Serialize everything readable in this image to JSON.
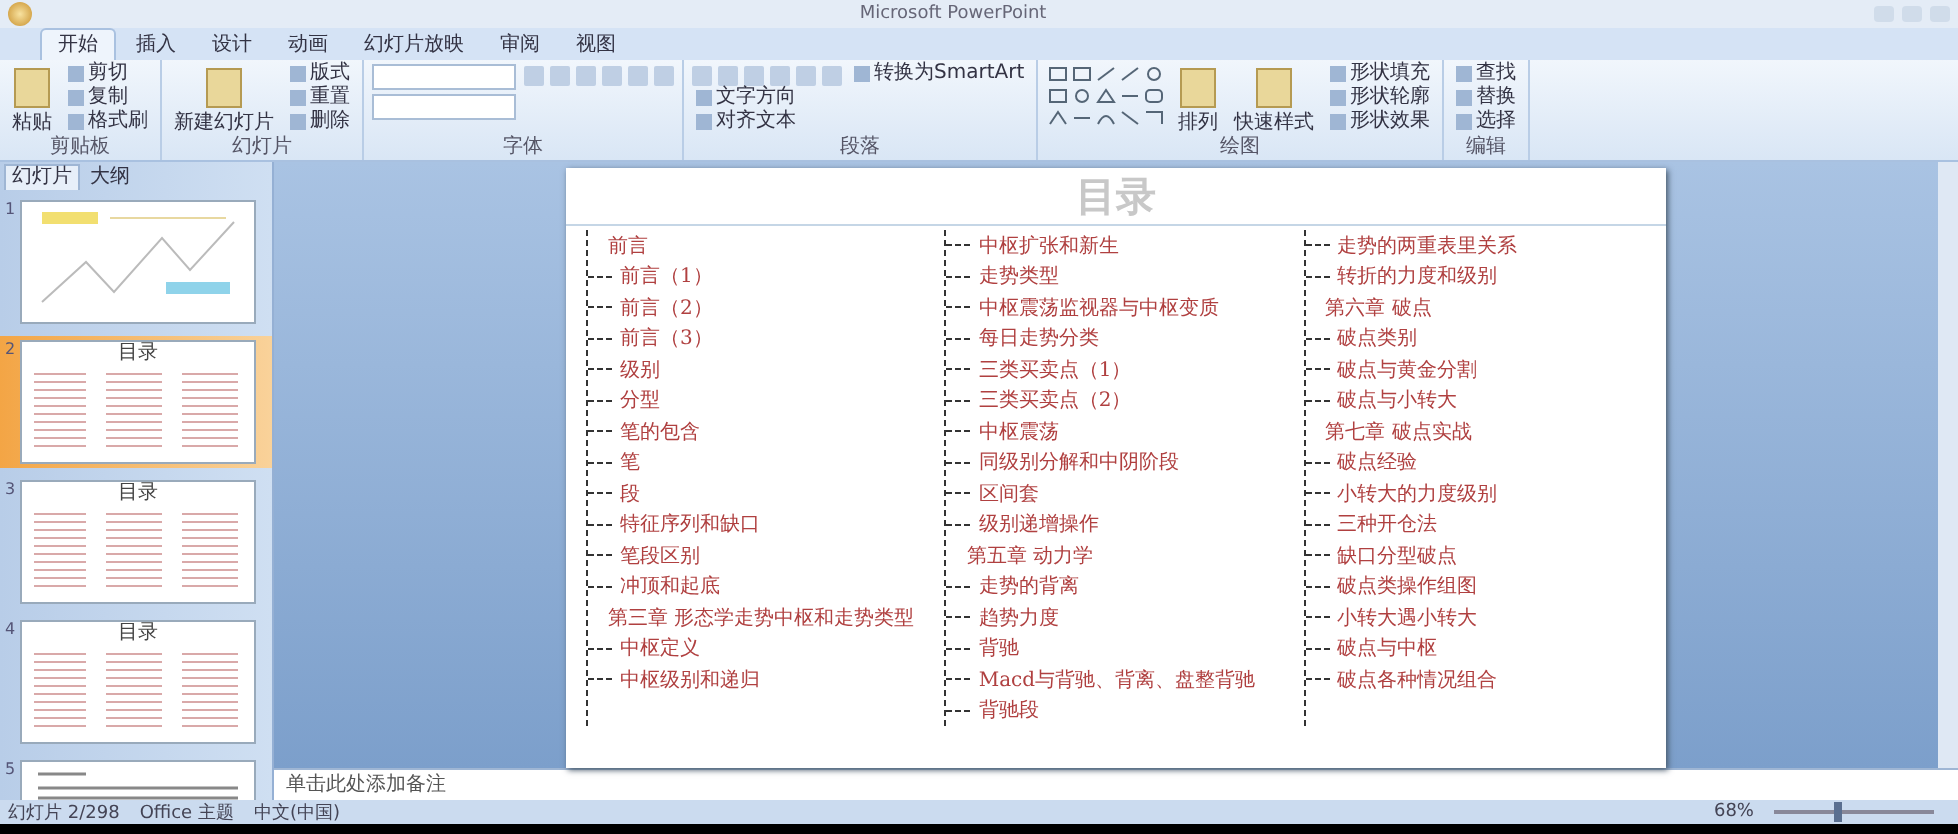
{
  "window": {
    "title": "Microsoft PowerPoint"
  },
  "ribbon_tabs": [
    {
      "label": "开始",
      "selected": true
    },
    {
      "label": "插入",
      "selected": false
    },
    {
      "label": "设计",
      "selected": false
    },
    {
      "label": "动画",
      "selected": false
    },
    {
      "label": "幻灯片放映",
      "selected": false
    },
    {
      "label": "审阅",
      "selected": false
    },
    {
      "label": "视图",
      "selected": false
    }
  ],
  "ribbon_groups": [
    {
      "label": "剪贴板",
      "items": [
        {
          "kind": "large",
          "label": "粘贴"
        },
        {
          "kind": "small",
          "label": "剪切"
        },
        {
          "kind": "small",
          "label": "复制"
        },
        {
          "kind": "small",
          "label": "格式刷"
        }
      ]
    },
    {
      "label": "幻灯片",
      "items": [
        {
          "kind": "large",
          "label": "新建幻灯片"
        },
        {
          "kind": "small",
          "label": "版式"
        },
        {
          "kind": "small",
          "label": "重置"
        },
        {
          "kind": "small",
          "label": "删除"
        }
      ]
    },
    {
      "label": "字体",
      "items": [
        {
          "kind": "field"
        },
        {
          "kind": "field"
        },
        {
          "kind": "tools"
        }
      ]
    },
    {
      "label": "段落",
      "items": [
        {
          "kind": "tools"
        },
        {
          "kind": "small",
          "label": "文字方向"
        },
        {
          "kind": "small",
          "label": "对齐文本"
        },
        {
          "kind": "small",
          "label": "转换为SmartArt"
        }
      ]
    },
    {
      "label": "绘图",
      "items": [
        {
          "kind": "shapes"
        },
        {
          "kind": "large",
          "label": "排列"
        },
        {
          "kind": "large",
          "label": "快速样式"
        },
        {
          "kind": "small",
          "label": "形状填充"
        },
        {
          "kind": "small",
          "label": "形状轮廓"
        },
        {
          "kind": "small",
          "label": "形状效果"
        }
      ]
    },
    {
      "label": "编辑",
      "items": [
        {
          "kind": "small",
          "label": "查找"
        },
        {
          "kind": "small",
          "label": "替换"
        },
        {
          "kind": "small",
          "label": "选择"
        }
      ]
    }
  ],
  "panel_tabs": [
    {
      "label": "幻灯片",
      "selected": true
    },
    {
      "label": "大纲",
      "selected": false
    }
  ],
  "thumbnails": [
    {
      "number": "1",
      "kind": "cover",
      "selected": false
    },
    {
      "number": "2",
      "kind": "toc",
      "title": "目录",
      "selected": true
    },
    {
      "number": "3",
      "kind": "toc",
      "title": "目录",
      "selected": false
    },
    {
      "number": "4",
      "kind": "toc",
      "title": "目录",
      "selected": false
    },
    {
      "number": "5",
      "kind": "text",
      "selected": false
    }
  ],
  "slide": {
    "title": "目录",
    "columns": [
      [
        {
          "kind": "heading",
          "text": "前言"
        },
        {
          "kind": "item",
          "text": "前言（1）"
        },
        {
          "kind": "item",
          "text": "前言（2）"
        },
        {
          "kind": "item",
          "text": "前言（3）"
        },
        {
          "kind": "item",
          "text": "级别"
        },
        {
          "kind": "item",
          "text": "分型"
        },
        {
          "kind": "item",
          "text": "笔的包含"
        },
        {
          "kind": "item",
          "text": "笔"
        },
        {
          "kind": "item",
          "text": "段"
        },
        {
          "kind": "item",
          "text": "特征序列和缺口"
        },
        {
          "kind": "item",
          "text": "笔段区别"
        },
        {
          "kind": "item",
          "text": "冲顶和起底"
        },
        {
          "kind": "heading",
          "text": "第三章 形态学走势中枢和走势类型"
        },
        {
          "kind": "item",
          "text": "中枢定义"
        },
        {
          "kind": "item",
          "text": "中枢级别和递归"
        }
      ],
      [
        {
          "kind": "item",
          "text": "中枢扩张和新生"
        },
        {
          "kind": "item",
          "text": "走势类型"
        },
        {
          "kind": "item",
          "text": "中枢震荡监视器与中枢变质"
        },
        {
          "kind": "item",
          "text": "每日走势分类"
        },
        {
          "kind": "item",
          "text": "三类买卖点（1）"
        },
        {
          "kind": "item",
          "text": "三类买卖点（2）"
        },
        {
          "kind": "item",
          "text": "中枢震荡"
        },
        {
          "kind": "item",
          "text": "同级别分解和中阴阶段"
        },
        {
          "kind": "item",
          "text": "区间套"
        },
        {
          "kind": "item",
          "text": "级别递增操作"
        },
        {
          "kind": "heading",
          "text": "第五章 动力学"
        },
        {
          "kind": "item",
          "text": "走势的背离"
        },
        {
          "kind": "item",
          "text": "趋势力度"
        },
        {
          "kind": "item",
          "text": "背驰"
        },
        {
          "kind": "item",
          "text": "Macd与背驰、背离、盘整背驰"
        },
        {
          "kind": "item",
          "text": "背驰段"
        }
      ],
      [
        {
          "kind": "item",
          "text": "走势的两重表里关系"
        },
        {
          "kind": "item",
          "text": "转折的力度和级别"
        },
        {
          "kind": "heading",
          "text": "第六章 破点"
        },
        {
          "kind": "item",
          "text": "破点类别"
        },
        {
          "kind": "item",
          "text": "破点与黄金分割"
        },
        {
          "kind": "item",
          "text": "破点与小转大"
        },
        {
          "kind": "heading",
          "text": "第七章 破点实战"
        },
        {
          "kind": "item",
          "text": "破点经验"
        },
        {
          "kind": "item",
          "text": "小转大的力度级别"
        },
        {
          "kind": "item",
          "text": "三种开仓法"
        },
        {
          "kind": "item",
          "text": "缺口分型破点"
        },
        {
          "kind": "item",
          "text": "破点类操作组图"
        },
        {
          "kind": "item",
          "text": "小转大遇小转大"
        },
        {
          "kind": "item",
          "text": "破点与中枢"
        },
        {
          "kind": "item",
          "text": "破点各种情况组合"
        }
      ]
    ]
  },
  "notes": {
    "placeholder": "单击此处添加备注"
  },
  "status_bar": {
    "slide_counter": "幻灯片 2/298",
    "theme": "Office 主题",
    "language": "中文(中国)",
    "zoom": "68%",
    "zoom_slider": {
      "level": 0.4
    }
  }
}
